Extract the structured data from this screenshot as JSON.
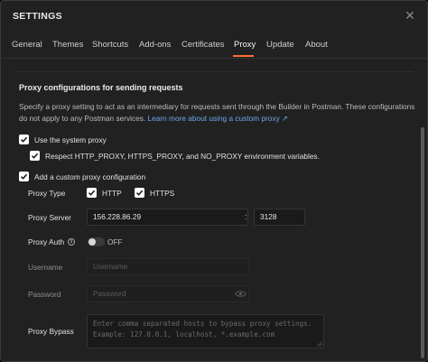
{
  "window": {
    "title": "SETTINGS",
    "close_glyph": "✕"
  },
  "tabs": [
    {
      "label": "General",
      "active": false
    },
    {
      "label": "Themes",
      "active": false
    },
    {
      "label": "Shortcuts",
      "active": false
    },
    {
      "label": "Add-ons",
      "active": false
    },
    {
      "label": "Certificates",
      "active": false
    },
    {
      "label": "Proxy",
      "active": true
    },
    {
      "label": "Update",
      "active": false
    },
    {
      "label": "About",
      "active": false
    }
  ],
  "proxy": {
    "section_title": "Proxy configurations for sending requests",
    "description": "Specify a proxy setting to act as an intermediary for requests sent through the Builder in Postman. These configurations do not apply to any Postman services.",
    "learn_more_link": "Learn more about using a custom proxy ↗",
    "use_system_proxy": {
      "label": "Use the system proxy",
      "checked": true
    },
    "respect_env": {
      "label": "Respect HTTP_PROXY, HTTPS_PROXY, and NO_PROXY environment variables.",
      "checked": true
    },
    "custom_proxy": {
      "label": "Add a custom proxy configuration",
      "checked": true
    },
    "proxy_type": {
      "label": "Proxy Type",
      "http": {
        "label": "HTTP",
        "checked": true
      },
      "https": {
        "label": "HTTPS",
        "checked": true
      }
    },
    "proxy_server": {
      "label": "Proxy Server",
      "host": "156.228.86.29",
      "separator": ":",
      "port": "3128"
    },
    "proxy_auth": {
      "label": "Proxy Auth",
      "info_glyph": "i",
      "enabled": false,
      "state_label": "OFF"
    },
    "username": {
      "label": "Username",
      "placeholder": "Username"
    },
    "password": {
      "label": "Password",
      "placeholder": "Password"
    },
    "bypass": {
      "label": "Proxy Bypass",
      "placeholder": "Enter comma separated hosts to bypass proxy settings.\nExample: 127.0.0.1, localhost, *.example.com"
    }
  },
  "colors": {
    "accent": "#ff6c37",
    "link": "#6ea7ee",
    "background": "#212121"
  }
}
